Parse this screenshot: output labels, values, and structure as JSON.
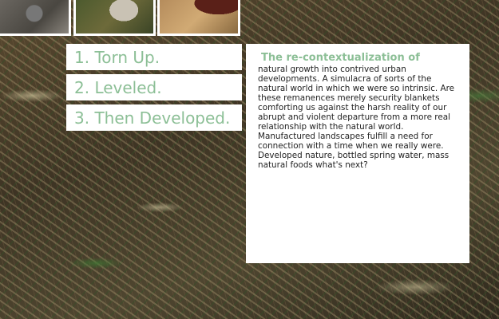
{
  "steps": [
    {
      "label": "1. Torn Up."
    },
    {
      "label": "2. Leveled."
    },
    {
      "label": "3. Then Developed."
    }
  ],
  "article": {
    "title": "The re-contextualization of",
    "body": "  natural growth into contrived urban developments. A simulacra of sorts of the natural world in which we were so intrinsic. Are these remanences merely security blankets comforting us against the harsh reality of our abrupt and violent departure from a more real relationship with the natural world. Manufactured landscapes fulfill a need for connection with a time when we really were. Developed nature, bottled spring water, mass natural foods what's next?"
  },
  "colors": {
    "accent": "#8cbf96",
    "panel": "#ffffff"
  }
}
